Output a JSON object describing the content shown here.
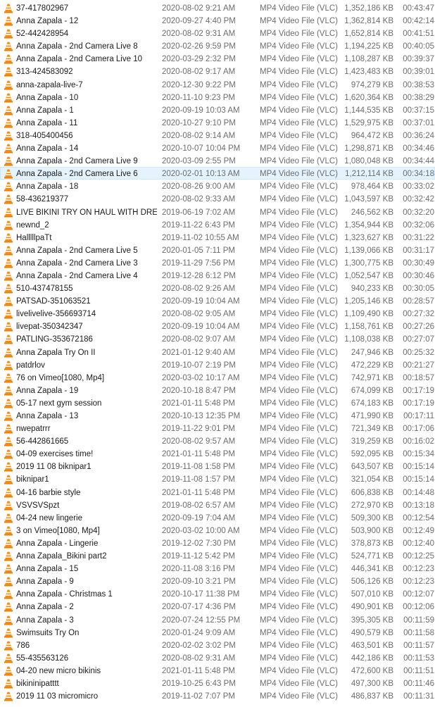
{
  "icon_name": "vlc-cone-icon",
  "selected_row_index": 13,
  "files": [
    {
      "name": "37-417802967",
      "date": "2020-08-02 9:21 AM",
      "type": "MP4 Video File (VLC)",
      "size": "1,352,186 KB",
      "length": "00:43:47"
    },
    {
      "name": "Anna Zapala - 12",
      "date": "2020-09-27 4:40 PM",
      "type": "MP4 Video File (VLC)",
      "size": "1,362,814 KB",
      "length": "00:42:14"
    },
    {
      "name": "52-442428954",
      "date": "2020-08-02 9:31 AM",
      "type": "MP4 Video File (VLC)",
      "size": "1,652,814 KB",
      "length": "00:41:51"
    },
    {
      "name": "Anna Zapala - 2nd Camera Live 8",
      "date": "2020-02-26 9:59 PM",
      "type": "MP4 Video File (VLC)",
      "size": "1,194,225 KB",
      "length": "00:40:05"
    },
    {
      "name": "Anna Zapala - 2nd Camera Live 10",
      "date": "2020-03-29 2:32 PM",
      "type": "MP4 Video File (VLC)",
      "size": "1,108,287 KB",
      "length": "00:39:37"
    },
    {
      "name": "313-424583092",
      "date": "2020-08-02 9:17 AM",
      "type": "MP4 Video File (VLC)",
      "size": "1,423,483 KB",
      "length": "00:39:01"
    },
    {
      "name": "anna-zapala-live-7",
      "date": "2020-12-30 9:22 PM",
      "type": "MP4 Video File (VLC)",
      "size": "974,279 KB",
      "length": "00:38:53"
    },
    {
      "name": "Anna Zapala - 10",
      "date": "2020-11-10 9:23 PM",
      "type": "MP4 Video File (VLC)",
      "size": "1,620,364 KB",
      "length": "00:38:29"
    },
    {
      "name": "Anna Zapala - 1",
      "date": "2020-09-19 10:03 AM",
      "type": "MP4 Video File (VLC)",
      "size": "1,144,535 KB",
      "length": "00:37:15"
    },
    {
      "name": "Anna Zapala - 11",
      "date": "2020-10-27 9:10 PM",
      "type": "MP4 Video File (VLC)",
      "size": "1,529,975 KB",
      "length": "00:37:01"
    },
    {
      "name": "318-405400456",
      "date": "2020-08-02 9:14 AM",
      "type": "MP4 Video File (VLC)",
      "size": "964,472 KB",
      "length": "00:36:24"
    },
    {
      "name": "Anna Zapala - 14",
      "date": "2020-10-07 10:04 PM",
      "type": "MP4 Video File (VLC)",
      "size": "1,298,871 KB",
      "length": "00:34:46"
    },
    {
      "name": "Anna Zapala - 2nd Camera Live 9",
      "date": "2020-03-09 2:55 PM",
      "type": "MP4 Video File (VLC)",
      "size": "1,080,048 KB",
      "length": "00:34:44"
    },
    {
      "name": "Anna Zapala - 2nd Camera Live 6",
      "date": "2020-02-01 10:13 AM",
      "type": "MP4 Video File (VLC)",
      "size": "1,212,114 KB",
      "length": "00:34:18"
    },
    {
      "name": "Anna Zapala - 18",
      "date": "2020-08-26 9:00 AM",
      "type": "MP4 Video File (VLC)",
      "size": "978,464 KB",
      "length": "00:33:02"
    },
    {
      "name": "58-436219377",
      "date": "2020-08-02 9:33 AM",
      "type": "MP4 Video File (VLC)",
      "size": "1,043,597 KB",
      "length": "00:32:42"
    },
    {
      "name": "LIVE  BIKINI TRY ON HAUL WITH DRESSLI...",
      "date": "2019-06-19 7:02 AM",
      "type": "MP4 Video File (VLC)",
      "size": "246,562 KB",
      "length": "00:32:20"
    },
    {
      "name": "newnd_2",
      "date": "2019-11-22 6:43 PM",
      "type": "MP4 Video File (VLC)",
      "size": "1,354,944 KB",
      "length": "00:32:06"
    },
    {
      "name": "HalllllpaTt",
      "date": "2019-11-02 10:55 AM",
      "type": "MP4 Video File (VLC)",
      "size": "1,323,627 KB",
      "length": "00:31:22"
    },
    {
      "name": "Anna Zapala - 2nd Camera Live 5",
      "date": "2020-01-05 7:11 PM",
      "type": "MP4 Video File (VLC)",
      "size": "1,139,066 KB",
      "length": "00:31:17"
    },
    {
      "name": "Anna Zapala - 2nd Camera Live 3",
      "date": "2019-11-29 7:56 PM",
      "type": "MP4 Video File (VLC)",
      "size": "1,300,775 KB",
      "length": "00:30:49"
    },
    {
      "name": "Anna Zapala - 2nd Camera Live 4",
      "date": "2019-12-28 6:12 PM",
      "type": "MP4 Video File (VLC)",
      "size": "1,052,547 KB",
      "length": "00:30:46"
    },
    {
      "name": "510-437478155",
      "date": "2020-08-02 9:26 AM",
      "type": "MP4 Video File (VLC)",
      "size": "940,233 KB",
      "length": "00:30:05"
    },
    {
      "name": "PATSAD-351063521",
      "date": "2020-09-19 10:04 AM",
      "type": "MP4 Video File (VLC)",
      "size": "1,205,146 KB",
      "length": "00:28:57"
    },
    {
      "name": "livelivelive-356693714",
      "date": "2020-08-02 9:05 AM",
      "type": "MP4 Video File (VLC)",
      "size": "1,109,490 KB",
      "length": "00:27:32"
    },
    {
      "name": "livepat-350342347",
      "date": "2020-09-19 10:04 AM",
      "type": "MP4 Video File (VLC)",
      "size": "1,158,761 KB",
      "length": "00:27:26"
    },
    {
      "name": "PATLING-353672186",
      "date": "2020-08-02 9:07 AM",
      "type": "MP4 Video File (VLC)",
      "size": "1,108,038 KB",
      "length": "00:27:07"
    },
    {
      "name": "Anna Zapala Try On II",
      "date": "2021-01-12 9:40 AM",
      "type": "MP4 Video File (VLC)",
      "size": "247,946 KB",
      "length": "00:25:32"
    },
    {
      "name": "patdrlov",
      "date": "2019-10-07 2:19 PM",
      "type": "MP4 Video File (VLC)",
      "size": "472,229 KB",
      "length": "00:21:27"
    },
    {
      "name": "76 on Vimeo[1080, Mp4]",
      "date": "2020-03-02 10:17 AM",
      "type": "MP4 Video File (VLC)",
      "size": "742,971 KB",
      "length": "00:18:57"
    },
    {
      "name": "Anna Zapala - 19",
      "date": "2020-10-18 8:47 PM",
      "type": "MP4 Video File (VLC)",
      "size": "674,099 KB",
      "length": "00:17:19"
    },
    {
      "name": "05-17 next gym session",
      "date": "2021-01-11 5:48 PM",
      "type": "MP4 Video File (VLC)",
      "size": "674,183 KB",
      "length": "00:17:19"
    },
    {
      "name": "Anna Zapala - 13",
      "date": "2020-10-13 12:35 PM",
      "type": "MP4 Video File (VLC)",
      "size": "471,990 KB",
      "length": "00:17:11"
    },
    {
      "name": "nwepatrrr",
      "date": "2019-11-22 9:01 PM",
      "type": "MP4 Video File (VLC)",
      "size": "721,349 KB",
      "length": "00:17:06"
    },
    {
      "name": "56-442861665",
      "date": "2020-08-02 9:57 AM",
      "type": "MP4 Video File (VLC)",
      "size": "319,259 KB",
      "length": "00:16:02"
    },
    {
      "name": "04-09 exercises time!",
      "date": "2021-01-11 5:48 PM",
      "type": "MP4 Video File (VLC)",
      "size": "592,095 KB",
      "length": "00:15:34"
    },
    {
      "name": "2019 11 08 biknipar1",
      "date": "2019-11-08 1:58 PM",
      "type": "MP4 Video File (VLC)",
      "size": "643,507 KB",
      "length": "00:15:14"
    },
    {
      "name": "biknipar1",
      "date": "2019-11-08 1:57 PM",
      "type": "MP4 Video File (VLC)",
      "size": "321,054 KB",
      "length": "00:15:14"
    },
    {
      "name": "04-16 barbie style",
      "date": "2021-01-11 5:48 PM",
      "type": "MP4 Video File (VLC)",
      "size": "606,838 KB",
      "length": "00:14:48"
    },
    {
      "name": "VSVSVSpzt",
      "date": "2019-08-02 6:57 AM",
      "type": "MP4 Video File (VLC)",
      "size": "272,970 KB",
      "length": "00:13:18"
    },
    {
      "name": "04-24 new lingerie",
      "date": "2020-09-19 7:04 AM",
      "type": "MP4 Video File (VLC)",
      "size": "509,300 KB",
      "length": "00:12:54"
    },
    {
      "name": "3 on Vimeo[1080, Mp4]",
      "date": "2020-03-02 10:00 AM",
      "type": "MP4 Video File (VLC)",
      "size": "503,900 KB",
      "length": "00:12:49"
    },
    {
      "name": "Anna Zapala - Lingerie",
      "date": "2019-12-02 7:30 PM",
      "type": "MP4 Video File (VLC)",
      "size": "378,873 KB",
      "length": "00:12:40"
    },
    {
      "name": "Anna Zapala_Bikini part2",
      "date": "2019-11-12 5:42 PM",
      "type": "MP4 Video File (VLC)",
      "size": "524,771 KB",
      "length": "00:12:25"
    },
    {
      "name": "Anna Zapala - 15",
      "date": "2020-11-08 3:16 PM",
      "type": "MP4 Video File (VLC)",
      "size": "446,341 KB",
      "length": "00:12:23"
    },
    {
      "name": "Anna Zapala - 9",
      "date": "2020-09-10 3:21 PM",
      "type": "MP4 Video File (VLC)",
      "size": "506,126 KB",
      "length": "00:12:23"
    },
    {
      "name": "Anna Zapala - Christmas 1",
      "date": "2020-10-17 11:38 PM",
      "type": "MP4 Video File (VLC)",
      "size": "507,010 KB",
      "length": "00:12:07"
    },
    {
      "name": "Anna Zapala - 2",
      "date": "2020-07-17 4:36 PM",
      "type": "MP4 Video File (VLC)",
      "size": "490,901 KB",
      "length": "00:12:06"
    },
    {
      "name": "Anna Zapala - 3",
      "date": "2020-07-24 12:55 PM",
      "type": "MP4 Video File (VLC)",
      "size": "395,305 KB",
      "length": "00:11:59"
    },
    {
      "name": "Swimsuits Try On",
      "date": "2020-01-24 9:09 AM",
      "type": "MP4 Video File (VLC)",
      "size": "490,579 KB",
      "length": "00:11:58"
    },
    {
      "name": "786",
      "date": "2020-02-02 3:02 PM",
      "type": "MP4 Video File (VLC)",
      "size": "463,501 KB",
      "length": "00:11:57"
    },
    {
      "name": "55-435563126",
      "date": "2020-08-02 9:31 AM",
      "type": "MP4 Video File (VLC)",
      "size": "442,186 KB",
      "length": "00:11:53"
    },
    {
      "name": "04-20 new micro bikinis",
      "date": "2021-01-11 5:48 PM",
      "type": "MP4 Video File (VLC)",
      "size": "472,600 KB",
      "length": "00:11:51"
    },
    {
      "name": "bikininipatttt",
      "date": "2019-10-25 6:43 PM",
      "type": "MP4 Video File (VLC)",
      "size": "497,300 KB",
      "length": "00:11:46"
    },
    {
      "name": "2019 11 03 micromicro",
      "date": "2019-11-02 7:07 PM",
      "type": "MP4 Video File (VLC)",
      "size": "486,837 KB",
      "length": "00:11:31"
    }
  ]
}
